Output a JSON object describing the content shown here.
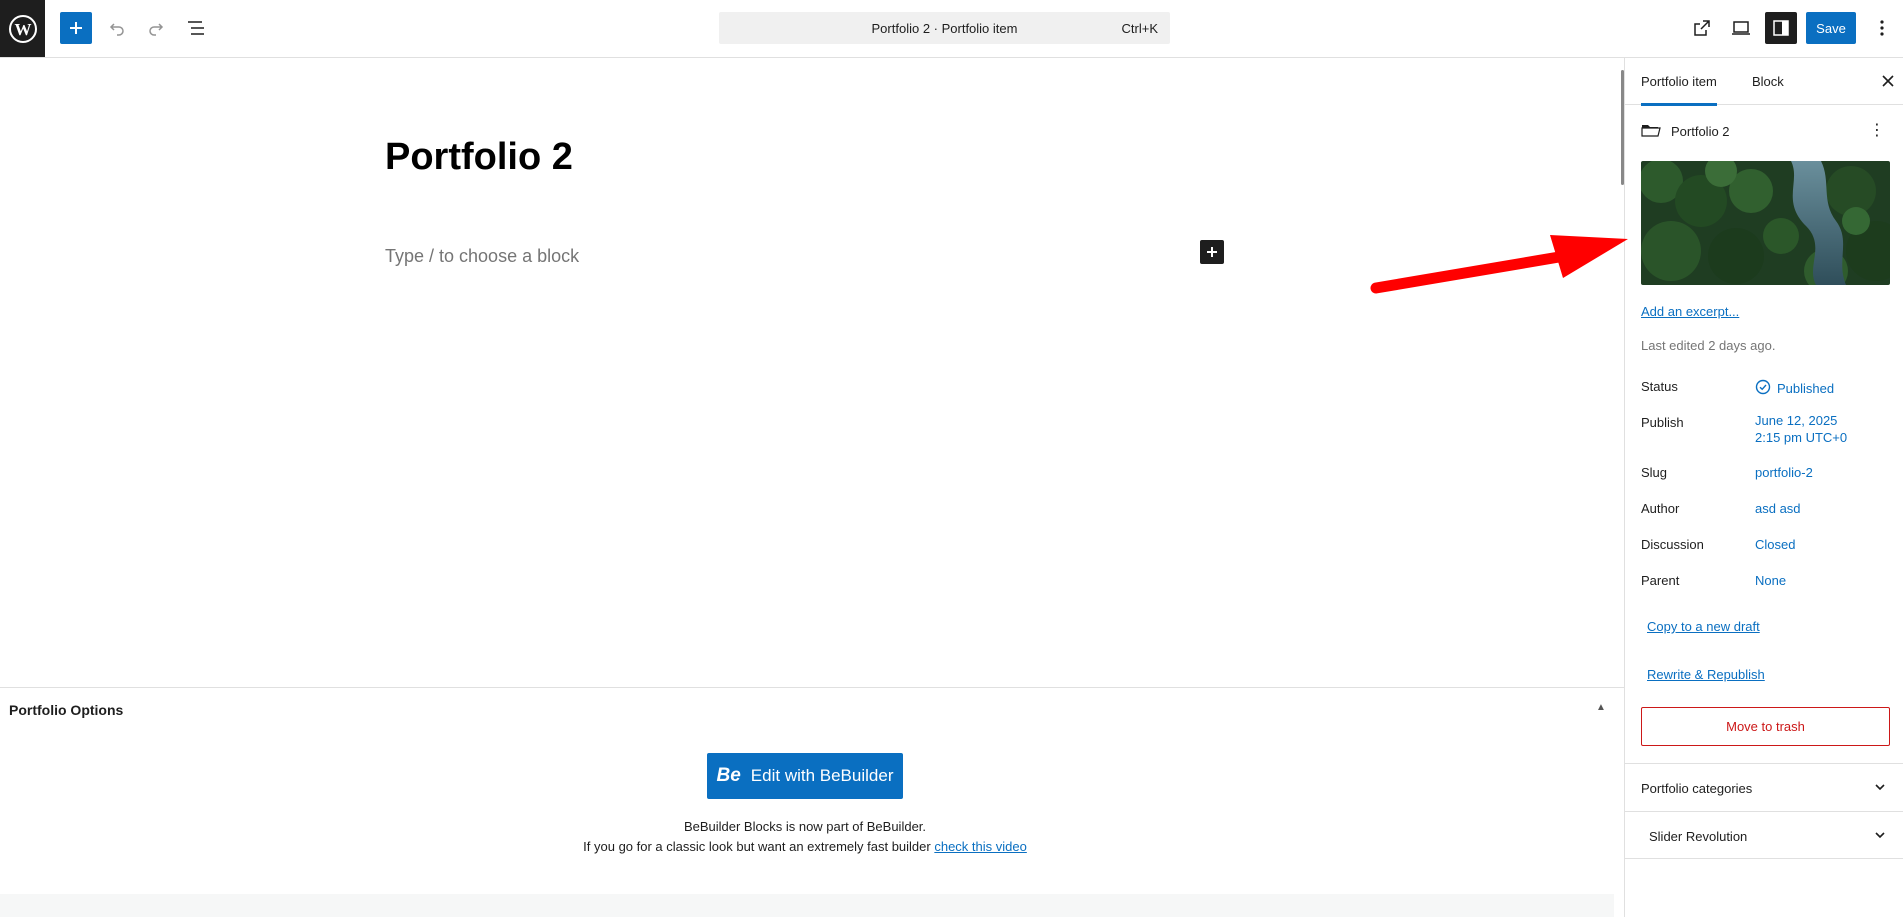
{
  "topbar": {
    "command_title": "Portfolio 2 · Portfolio item",
    "command_shortcut": "Ctrl+K",
    "save_label": "Save"
  },
  "editor": {
    "post_title": "Portfolio 2",
    "block_placeholder": "Type / to choose a block"
  },
  "metabox": {
    "title": "Portfolio Options",
    "bebuilder_logo": "Be",
    "bebuilder_button": "Edit with BeBuilder",
    "note_line1": "BeBuilder Blocks is now part of BeBuilder.",
    "note_line2": "If you go for a classic look but want an extremely fast builder",
    "note_link": "check this video"
  },
  "sidebar": {
    "tabs": [
      {
        "label": "Portfolio item",
        "active": true
      },
      {
        "label": "Block",
        "active": false
      }
    ],
    "post_name": "Portfolio 2",
    "excerpt_link": "Add an excerpt...",
    "last_edited": "Last edited 2 days ago.",
    "rows": {
      "status": {
        "label": "Status",
        "value": "Published"
      },
      "publish": {
        "label": "Publish",
        "value_line1": "June 12, 2025",
        "value_line2": "2:15 pm UTC+0"
      },
      "slug": {
        "label": "Slug",
        "value": "portfolio-2"
      },
      "author": {
        "label": "Author",
        "value": "asd asd"
      },
      "discussion": {
        "label": "Discussion",
        "value": "Closed"
      },
      "parent": {
        "label": "Parent",
        "value": "None"
      }
    },
    "copy_draft": "Copy to a new draft",
    "rewrite": "Rewrite & Republish",
    "trash": "Move to trash",
    "panels": [
      {
        "label": "Portfolio categories"
      },
      {
        "label": "Slider Revolution"
      }
    ]
  },
  "colors": {
    "accent": "#0a6fc1",
    "danger": "#cc1818",
    "annotation_arrow": "#f00"
  }
}
